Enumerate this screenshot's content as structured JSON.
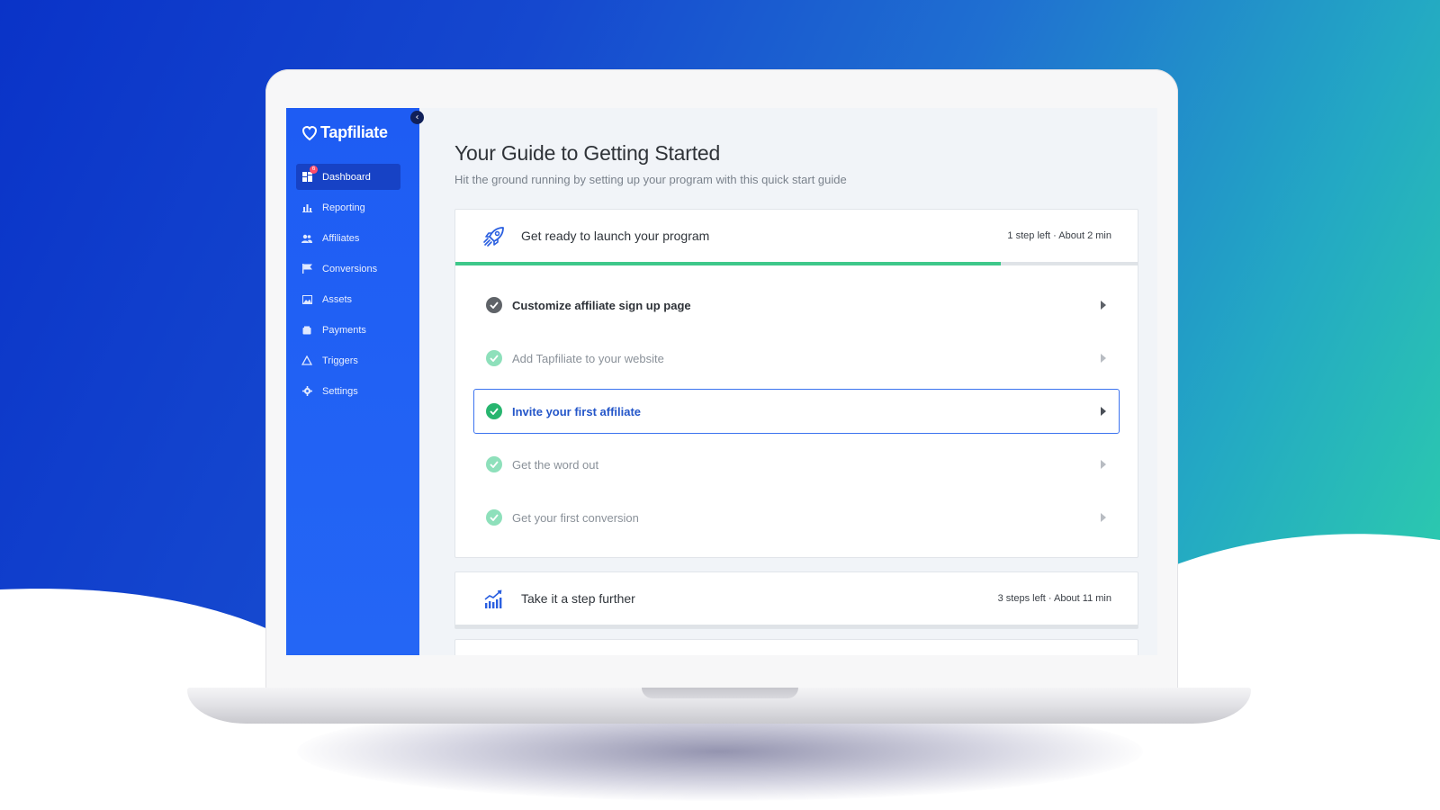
{
  "colors": {
    "sidebar": "#2466f5",
    "sidebar_active": "#1742c5",
    "progress": "#3ec88a",
    "active_step_text": "#2456c9",
    "active_step_border": "#3c73ef"
  },
  "app": {
    "logo_text": "Tapfiliate"
  },
  "sidebar": {
    "items": [
      {
        "label": "Dashboard",
        "icon": "dashboard-icon",
        "active": true,
        "badge": "6"
      },
      {
        "label": "Reporting",
        "icon": "bar-chart-icon"
      },
      {
        "label": "Affiliates",
        "icon": "users-icon"
      },
      {
        "label": "Conversions",
        "icon": "flag-icon"
      },
      {
        "label": "Assets",
        "icon": "image-icon"
      },
      {
        "label": "Payments",
        "icon": "wallet-icon"
      },
      {
        "label": "Triggers",
        "icon": "triangle-icon"
      },
      {
        "label": "Settings",
        "icon": "gear-icon"
      }
    ]
  },
  "main": {
    "title": "Your Guide to Getting Started",
    "subtitle": "Hit the ground running by setting up your program with this quick start guide",
    "sections": [
      {
        "title": "Get ready to launch your program",
        "meta": "1 step left · About 2 min",
        "icon": "rocket-icon",
        "progress": 0.8,
        "steps": [
          {
            "label": "Customize affiliate sign up page",
            "state": "done"
          },
          {
            "label": "Add Tapfiliate to your website",
            "state": "pending"
          },
          {
            "label": "Invite your first affiliate",
            "state": "active"
          },
          {
            "label": "Get the word out",
            "state": "pending"
          },
          {
            "label": "Get your first conversion",
            "state": "pending"
          }
        ]
      },
      {
        "title": "Take it a step further",
        "meta": "3 steps left · About 11 min",
        "icon": "growth-chart-icon"
      }
    ]
  }
}
